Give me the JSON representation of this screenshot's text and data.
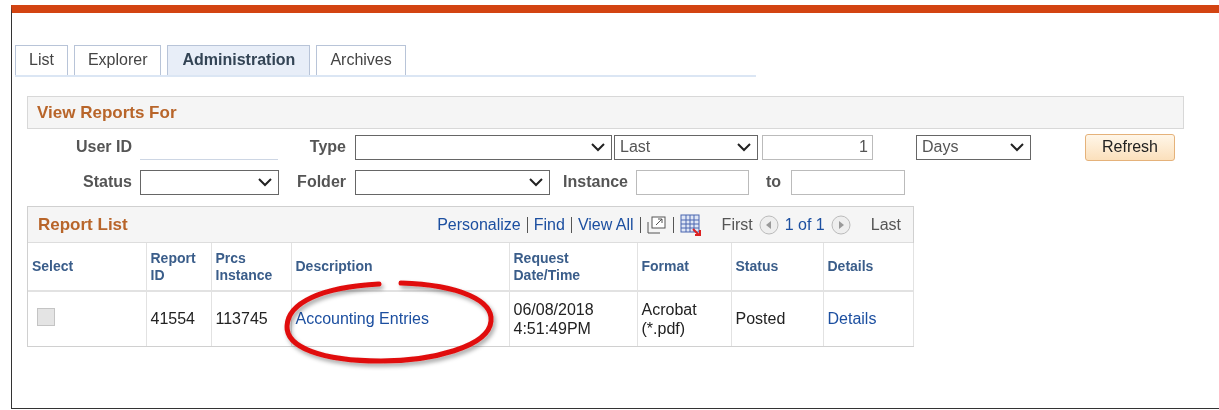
{
  "tabs": [
    {
      "label": "List",
      "selected": false
    },
    {
      "label": "Explorer",
      "selected": false
    },
    {
      "label": "Administration",
      "selected": true
    },
    {
      "label": "Archives",
      "selected": false
    }
  ],
  "filters": {
    "title": "View Reports For",
    "rows": [
      [
        {
          "kind": "label",
          "text": "User ID"
        },
        {
          "kind": "input"
        },
        {
          "kind": "label",
          "text": "Type"
        },
        {
          "kind": "select"
        },
        {
          "kind": "select",
          "value": "Last"
        },
        {
          "kind": "input",
          "value": "1"
        },
        {
          "kind": "select",
          "value": "Days"
        },
        {
          "kind": "button",
          "text": "Refresh"
        }
      ],
      [
        {
          "kind": "label",
          "text": "Status"
        },
        {
          "kind": "select"
        },
        {
          "kind": "label",
          "text": "Folder"
        },
        {
          "kind": "select"
        },
        {
          "kind": "label",
          "text": "Instance"
        },
        {
          "kind": "input"
        },
        {
          "kind": "label",
          "text": "to"
        },
        {
          "kind": "input"
        }
      ]
    ]
  },
  "report_list": {
    "title": "Report List",
    "links": [
      "Personalize",
      "Find",
      "View All"
    ],
    "first": "First",
    "page": "1 of 1",
    "last": "Last",
    "columns": [
      "Select",
      "Report ID",
      "Prcs Instance",
      "Description",
      "Request Date/Time",
      "Format",
      "Status",
      "Details"
    ],
    "rows": [
      {
        "checked": false,
        "disabled": true,
        "report_id": "41554",
        "prcs_instance": "113745",
        "description": "Accounting Entries",
        "request_date": "06/08/2018",
        "request_time": "4:51:49PM",
        "format": "Acrobat (*.pdf)",
        "status": "Posted",
        "details": "Details"
      }
    ]
  }
}
